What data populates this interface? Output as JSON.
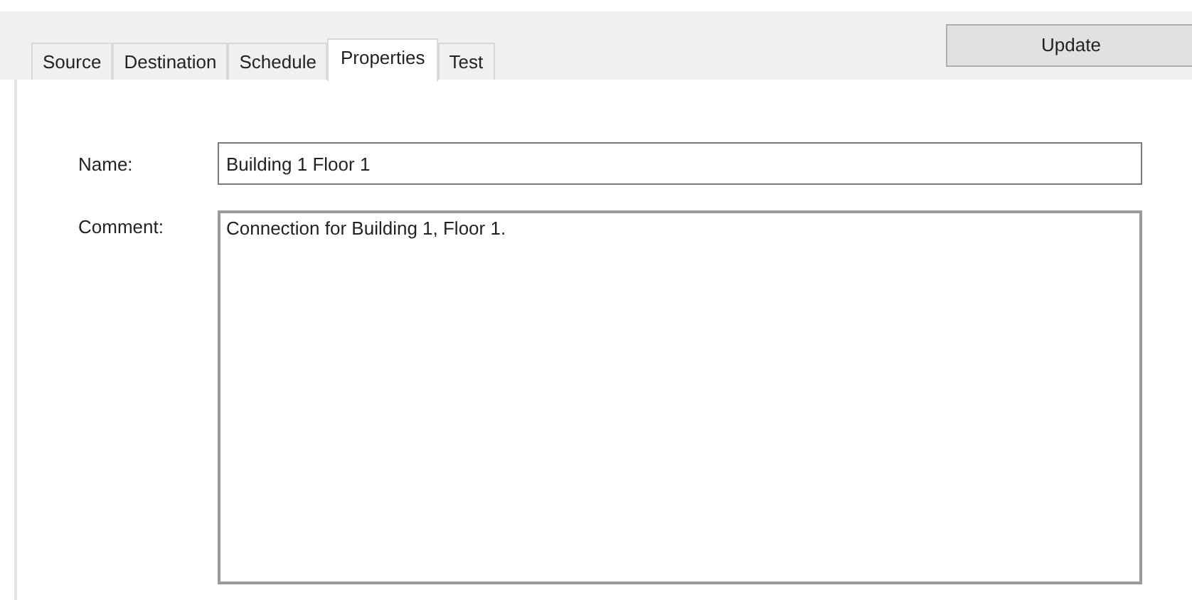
{
  "tabs": [
    {
      "label": "Source",
      "selected": false
    },
    {
      "label": "Destination",
      "selected": false
    },
    {
      "label": "Schedule",
      "selected": false
    },
    {
      "label": "Properties",
      "selected": true
    },
    {
      "label": "Test",
      "selected": false
    }
  ],
  "update_button": "Update",
  "form": {
    "name_label": "Name:",
    "name_value": "Building 1 Floor 1",
    "comment_label": "Comment:",
    "comment_value": "Connection for Building 1, Floor 1."
  }
}
